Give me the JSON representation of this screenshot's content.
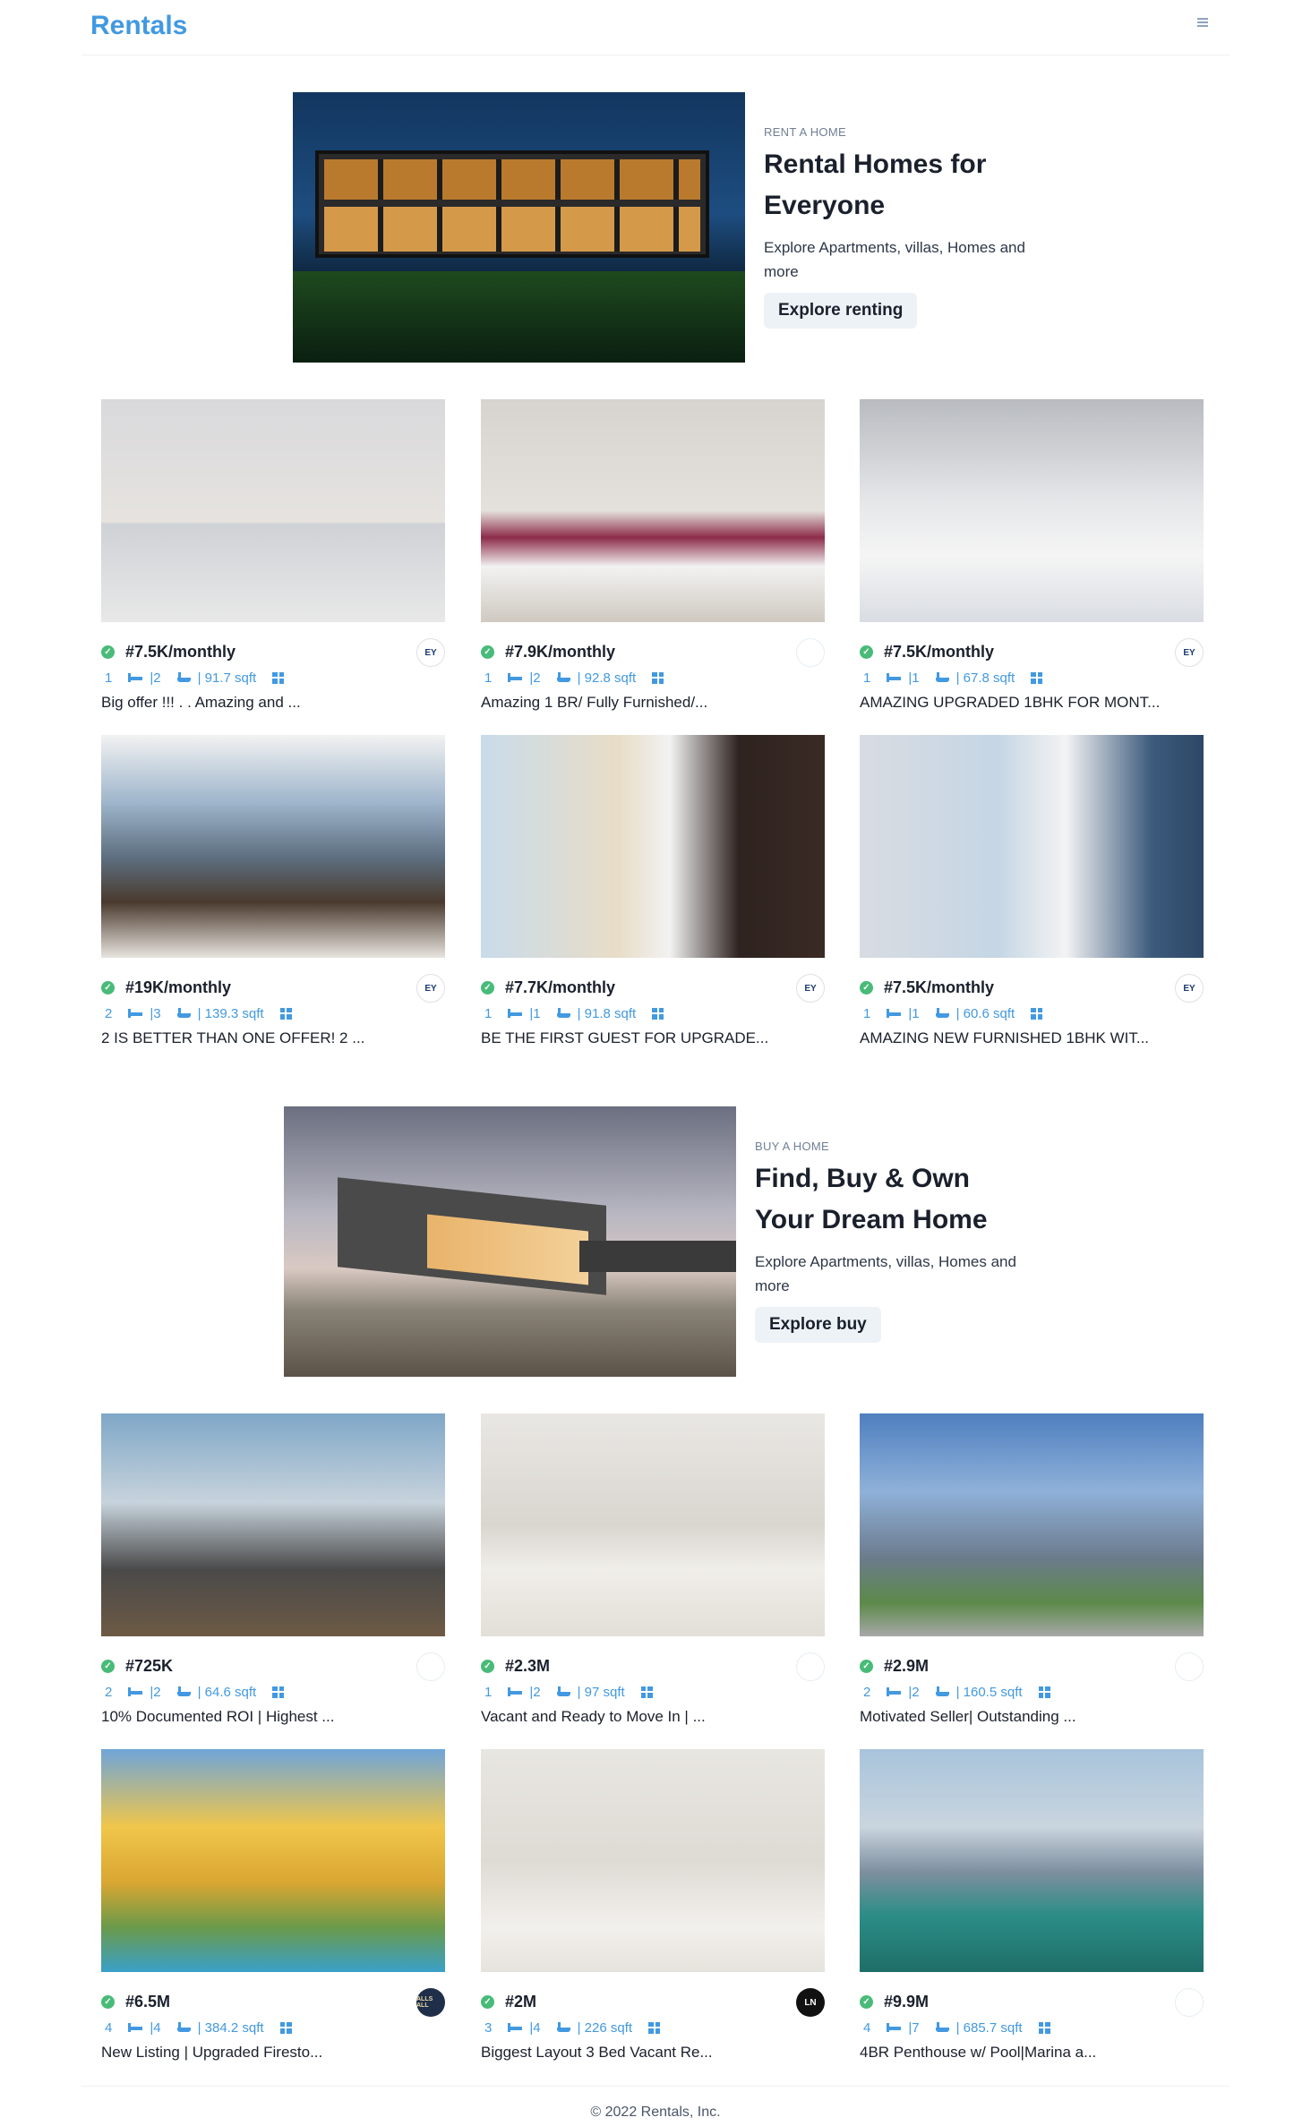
{
  "header": {
    "logo": "Rentals",
    "menu_icon": "hamburger-icon"
  },
  "rent_hero": {
    "kicker": "RENT A HOME",
    "title": "Rental Homes for Everyone",
    "description": "Explore Apartments, villas, Homes and more",
    "button": "Explore renting"
  },
  "buy_hero": {
    "kicker": "BUY A HOME",
    "title": "Find, Buy & Own Your Dream Home",
    "description": "Explore Apartments, villas, Homes and more",
    "button": "Explore buy"
  },
  "rent_listings": [
    {
      "price": "#7.5K/monthly",
      "beds": "1",
      "baths": "|2",
      "area": "| 91.7 sqft",
      "title": "Big offer !!! . . Amazing and ...",
      "agency": "EY"
    },
    {
      "price": "#7.9K/monthly",
      "beds": "1",
      "baths": "|2",
      "area": "| 92.8 sqft",
      "title": "Amazing 1 BR/ Fully Furnished/...",
      "agency": ""
    },
    {
      "price": "#7.5K/monthly",
      "beds": "1",
      "baths": "|1",
      "area": "| 67.8 sqft",
      "title": "AMAZING UPGRADED 1BHK FOR MONT...",
      "agency": "EY"
    },
    {
      "price": "#19K/monthly",
      "beds": "2",
      "baths": "|3",
      "area": "| 139.3 sqft",
      "title": "2 IS BETTER THAN ONE OFFER! 2 ...",
      "agency": "EY"
    },
    {
      "price": "#7.7K/monthly",
      "beds": "1",
      "baths": "|1",
      "area": "| 91.8 sqft",
      "title": "BE THE FIRST GUEST FOR UPGRADE...",
      "agency": "EY"
    },
    {
      "price": "#7.5K/monthly",
      "beds": "1",
      "baths": "|1",
      "area": "| 60.6 sqft",
      "title": "AMAZING NEW FURNISHED 1BHK WIT...",
      "agency": "EY"
    }
  ],
  "buy_listings": [
    {
      "price": "#725K",
      "beds": "2",
      "baths": "|2",
      "area": "| 64.6 sqft",
      "title": "10% Documented ROI | Highest ...",
      "agency": ""
    },
    {
      "price": "#2.3M",
      "beds": "1",
      "baths": "|2",
      "area": "| 97 sqft",
      "title": "Vacant and Ready to Move In | ...",
      "agency": ""
    },
    {
      "price": "#2.9M",
      "beds": "2",
      "baths": "|2",
      "area": "| 160.5 sqft",
      "title": "Motivated Seller| Outstanding ...",
      "agency": ""
    },
    {
      "price": "#6.5M",
      "beds": "4",
      "baths": "|4",
      "area": "| 384.2 sqft",
      "title": "New Listing | Upgraded Firesto...",
      "agency": "ALLS ALL"
    },
    {
      "price": "#2M",
      "beds": "3",
      "baths": "|4",
      "area": "| 226 sqft",
      "title": "Biggest Layout 3 Bed Vacant Re...",
      "agency": "LN"
    },
    {
      "price": "#9.9M",
      "beds": "4",
      "baths": "|7",
      "area": "| 685.7 sqft",
      "title": "4BR Penthouse w/ Pool|Marina a...",
      "agency": ""
    }
  ],
  "footer": {
    "copyright": "© 2022 Rentals, Inc."
  }
}
